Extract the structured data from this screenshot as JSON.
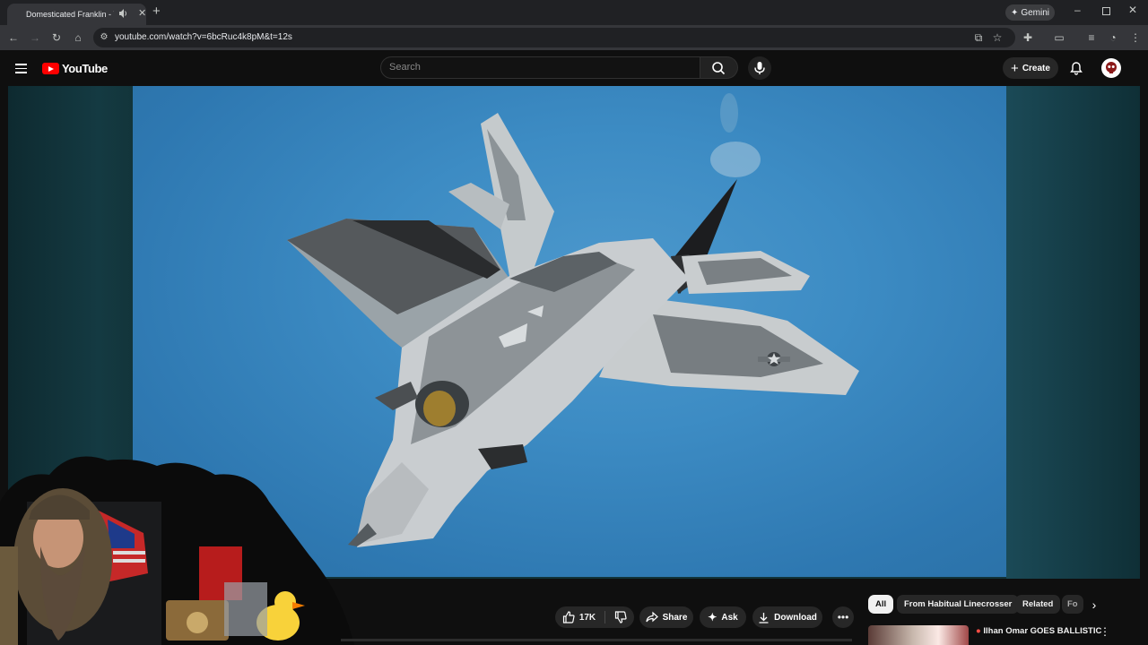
{
  "browser": {
    "tab_title": "Domesticated Franklin - Yo",
    "url": "youtube.com/watch?v=6bcRuc4k8pM&t=12s",
    "gemini_label": "Gemini"
  },
  "masthead": {
    "logo_text": "YouTube",
    "search_placeholder": "Search",
    "create_label": "Create"
  },
  "actions": {
    "like_count": "17K",
    "share_label": "Share",
    "ask_label": "Ask",
    "download_label": "Download"
  },
  "chips": [
    {
      "label": "All",
      "active": true
    },
    {
      "label": "From Habitual Linecrosser",
      "active": false
    },
    {
      "label": "Related",
      "active": false
    },
    {
      "label": "Fo",
      "active": false
    }
  ],
  "recommendation": {
    "title": "Ilhan Omar GOES BALLISTIC"
  },
  "colors": {
    "background": "#0f0f0f",
    "brand_red": "#ff0000",
    "sky": "#3d8cc4"
  }
}
